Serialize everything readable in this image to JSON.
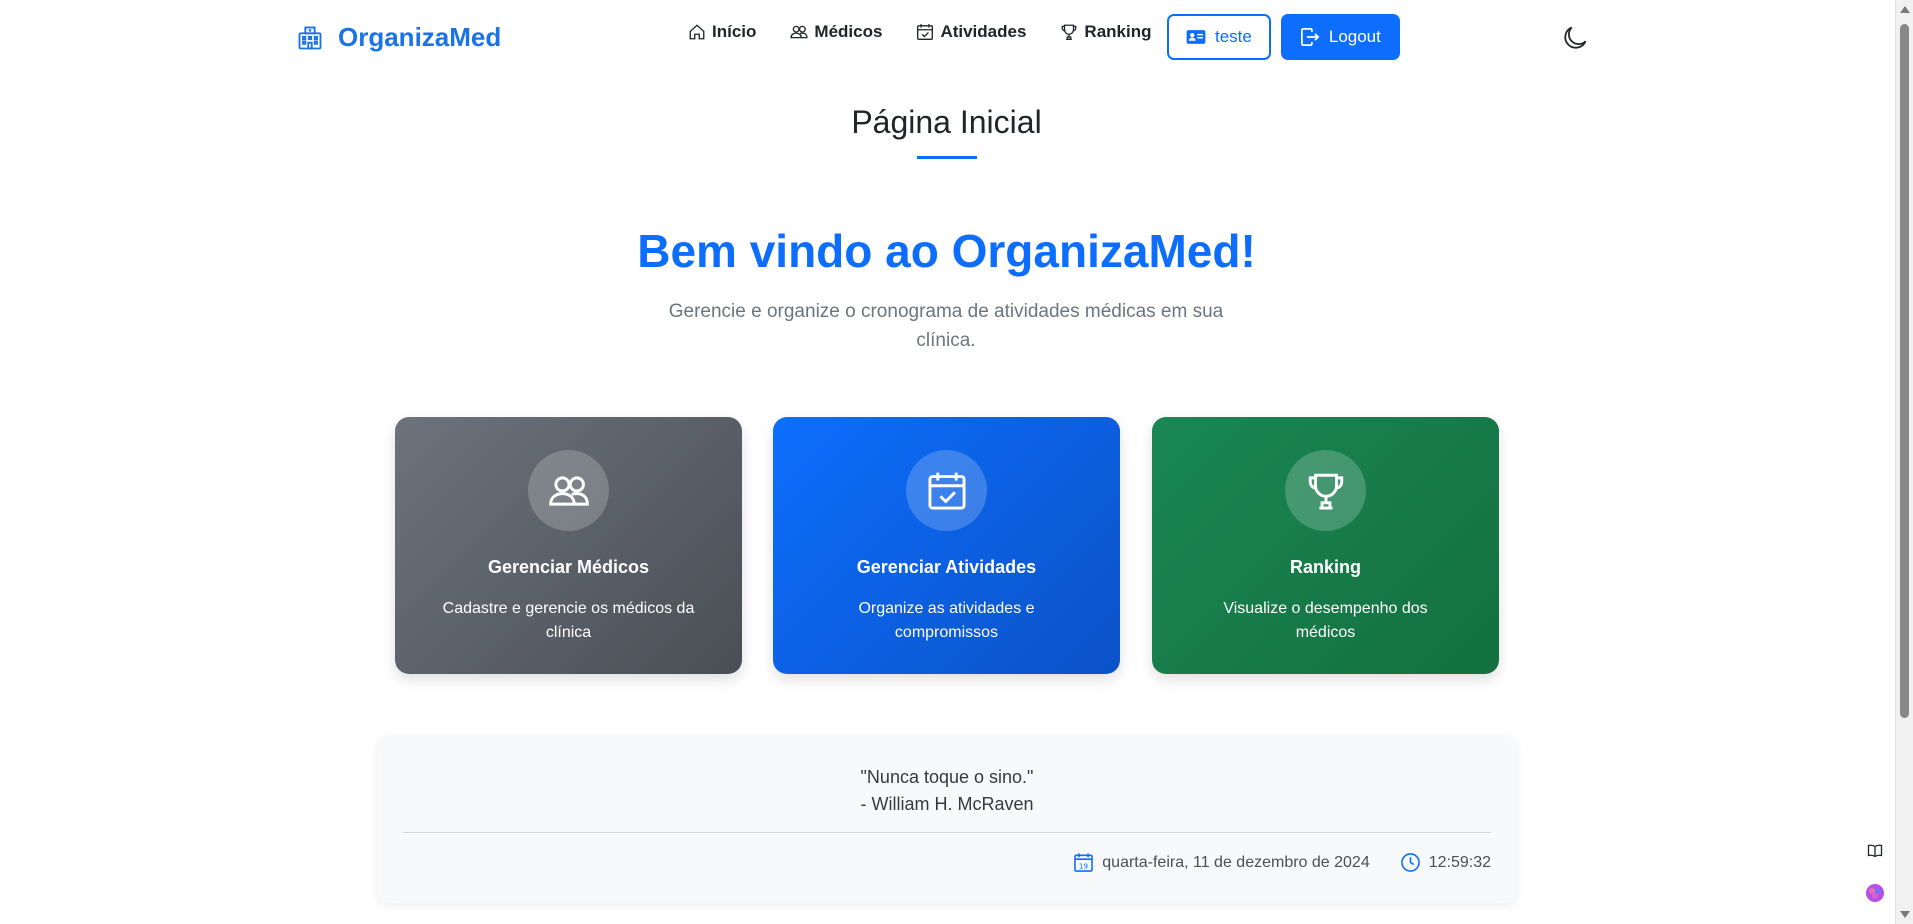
{
  "brand": {
    "name": "OrganizaMed",
    "icon": "hospital-icon"
  },
  "nav": {
    "items": [
      {
        "label": "Início",
        "icon": "house-icon"
      },
      {
        "label": "Médicos",
        "icon": "people-icon"
      },
      {
        "label": "Atividades",
        "icon": "calendar-check-icon"
      },
      {
        "label": "Ranking",
        "icon": "trophy-icon"
      }
    ],
    "user_label": "teste",
    "logout_label": "Logout",
    "theme_icon": "moon-icon"
  },
  "page": {
    "title": "Página Inicial",
    "welcome": "Bem vindo ao OrganizaMed!",
    "subtitle": "Gerencie e organize o cronograma de atividades médicas em sua clínica."
  },
  "cards": [
    {
      "title": "Gerenciar Médicos",
      "description": "Cadastre e gerencie os médicos da clínica",
      "icon": "people-icon",
      "color": "#5c6269"
    },
    {
      "title": "Gerenciar Atividades",
      "description": "Organize as atividades e compromissos",
      "icon": "calendar-check-icon",
      "color": "#0d6efd"
    },
    {
      "title": "Ranking",
      "description": "Visualize o desempenho dos médicos",
      "icon": "trophy-icon",
      "color": "#198754"
    }
  ],
  "quote": {
    "text": "\"Nunca toque o sino.\"",
    "author": "- William H. McRaven",
    "date": "quarta-feira, 11 de dezembro de 2024",
    "time": "12:59:32"
  },
  "colors": {
    "primary": "#0d6efd",
    "secondary": "#6c757d",
    "success": "#198754"
  }
}
